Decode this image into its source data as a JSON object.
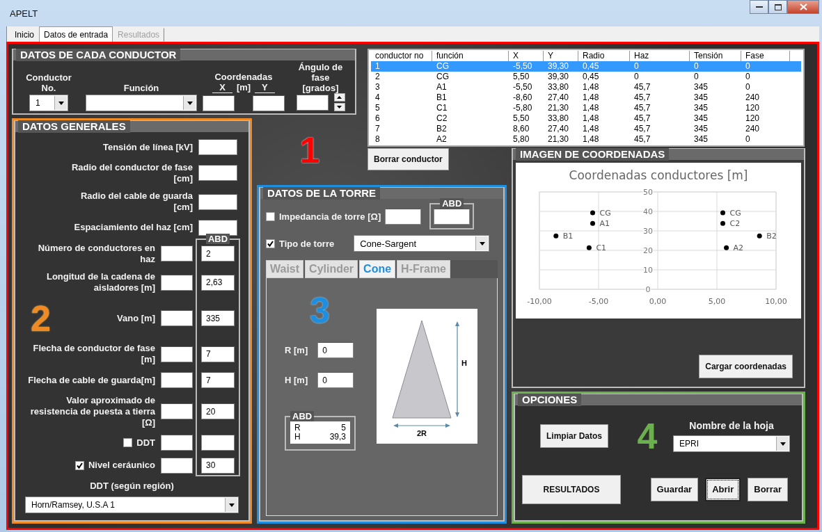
{
  "window": {
    "title": "APELT"
  },
  "tabs": [
    {
      "label": "Inicio",
      "selected": false,
      "disabled": false
    },
    {
      "label": "Datos de entrada",
      "selected": true,
      "disabled": false
    },
    {
      "label": "Resultados",
      "selected": false,
      "disabled": true
    }
  ],
  "frame": {
    "marker": "1",
    "color": "#ff0000"
  },
  "conductor_data": {
    "title": "DATOS DE CADA CONDUCTOR",
    "conductor_label": "Conductor No.",
    "conductor_value": "1",
    "function_label": "Función",
    "coords_label": "Coordenadas",
    "x_label": "X",
    "unit_label": "[m]",
    "y_label": "Y",
    "angle_label": "Ángulo de fase [grados]"
  },
  "table": {
    "columns": [
      "conductor no",
      "función",
      "X",
      "Y",
      "Radio",
      "Haz",
      "Tensión",
      "Fase"
    ],
    "rows": [
      {
        "cells": [
          "1",
          "CG",
          "-5,50",
          "39,30",
          "0,45",
          "0",
          "0",
          "0"
        ],
        "selected": true
      },
      {
        "cells": [
          "2",
          "CG",
          "5,50",
          "39,30",
          "0,45",
          "0",
          "0",
          "0"
        ],
        "selected": false
      },
      {
        "cells": [
          "3",
          "A1",
          "-5,50",
          "33,80",
          "1,48",
          "45,7",
          "345",
          "0"
        ],
        "selected": false
      },
      {
        "cells": [
          "4",
          "B1",
          "-8,60",
          "27,40",
          "1,48",
          "45,7",
          "345",
          "240"
        ],
        "selected": false
      },
      {
        "cells": [
          "5",
          "C1",
          "-5,80",
          "21,30",
          "1,48",
          "45,7",
          "345",
          "120"
        ],
        "selected": false
      },
      {
        "cells": [
          "6",
          "C2",
          "5,50",
          "33,80",
          "1,48",
          "45,7",
          "345",
          "120"
        ],
        "selected": false
      },
      {
        "cells": [
          "7",
          "B2",
          "8,60",
          "27,40",
          "1,48",
          "45,7",
          "345",
          "240"
        ],
        "selected": false
      },
      {
        "cells": [
          "8",
          "A2",
          "5,80",
          "21,30",
          "1,48",
          "45,7",
          "345",
          "0"
        ],
        "selected": false
      }
    ]
  },
  "delete_button": "Borrar conductor",
  "general": {
    "title": "DATOS GENERALES",
    "marker": "2",
    "color": "#f08a24",
    "abd_title": "ABD",
    "fields": [
      {
        "kind": "text",
        "label": "Tensión de línea [kV]",
        "has_abd": false
      },
      {
        "kind": "text",
        "label": "Radio del conductor de fase [cm]",
        "has_abd": false
      },
      {
        "kind": "text",
        "label": "Radio del cable de guarda [cm]",
        "has_abd": false
      },
      {
        "kind": "text",
        "label": "Espaciamiento del haz [cm]",
        "has_abd": false
      },
      {
        "kind": "text",
        "label": "Número de conductores en haz",
        "has_abd": true,
        "abd": "2"
      },
      {
        "kind": "text",
        "label": "Longitud de la cadena de aisladores [m]",
        "has_abd": true,
        "abd": "2,63"
      },
      {
        "kind": "text",
        "label": "Vano [m]",
        "has_abd": true,
        "abd": "335"
      },
      {
        "kind": "text",
        "label": "Flecha de conductor de fase [m]",
        "has_abd": true,
        "abd": "7"
      },
      {
        "kind": "text",
        "label": "Flecha de cable de guarda[m]",
        "has_abd": true,
        "abd": "7"
      },
      {
        "kind": "text",
        "label": "Valor aproximado de resistencia de puesta a tierra [Ω]",
        "has_abd": true,
        "abd": "20"
      },
      {
        "kind": "checkbox",
        "label": "DDT",
        "checked": false,
        "has_abd": true
      },
      {
        "kind": "checkbox",
        "label": "Nivel ceráunico",
        "checked": true,
        "has_abd": true,
        "abd": "30"
      }
    ],
    "region_label": "DDT (según región)",
    "region_value": "Horn/Ramsey, U.S.A 1"
  },
  "tower": {
    "title": "DATOS DE LA TORRE",
    "marker": "3",
    "color": "#1e8fe0",
    "abd_title": "ABD",
    "impedance": {
      "label": "Impedancia de torre [Ω]",
      "checked": false
    },
    "type": {
      "label": "Tipo de torre",
      "checked": true,
      "value": "Cone-Sargent"
    },
    "tabs": [
      {
        "label": "Waist",
        "selected": false
      },
      {
        "label": "Cylinder",
        "selected": false
      },
      {
        "label": "Cone",
        "selected": true
      },
      {
        "label": "H-Frame",
        "selected": false
      }
    ],
    "r_label": "R [m]",
    "r_value": "0",
    "h_label": "H [m]",
    "h_value": "0",
    "diagram": {
      "height_label": "H",
      "base_label": "2R"
    },
    "abd_box": {
      "title": "ABD",
      "rows": [
        {
          "name": "R",
          "value": "5"
        },
        {
          "name": "H",
          "value": "39,3"
        }
      ]
    }
  },
  "coords": {
    "title": "IMAGEN DE COORDENADAS",
    "load_button": "Cargar coordenadas",
    "chart_data": {
      "type": "scatter",
      "title": "Coordenadas conductores [m]",
      "x": [
        -5.5,
        5.5,
        -5.5,
        -8.6,
        -5.8,
        5.5,
        8.6,
        5.8
      ],
      "grid": true,
      "series": [
        {
          "color": "#000000",
          "values": [
            39.3,
            39.3,
            33.8,
            27.4,
            21.3,
            33.8,
            27.4,
            21.3
          ]
        }
      ],
      "value_labels": [
        "CG",
        "CG",
        "A1",
        "B1",
        "C1",
        "C2",
        "B2",
        "A2"
      ],
      "xlim": [
        -10,
        10
      ],
      "ylim": [
        0,
        50
      ],
      "xticks": [
        {
          "value": -10,
          "label": "-10,00"
        },
        {
          "value": -5,
          "label": "-5,00"
        },
        {
          "value": 0,
          "label": "0,00"
        },
        {
          "value": 5,
          "label": "5,00"
        },
        {
          "value": 10,
          "label": "10,00"
        }
      ],
      "yticks": [
        0,
        10,
        20,
        30,
        40,
        50
      ]
    }
  },
  "options": {
    "title": "OPCIONES",
    "marker": "4",
    "color": "#6ab04c",
    "clear_button": "Limpiar Datos",
    "sheet_label": "Nombre de la hoja",
    "sheet_value": "EPRI",
    "results_button": "RESULTADOS",
    "buttons": [
      {
        "label": "Guardar",
        "focused": false
      },
      {
        "label": "Abrir",
        "focused": true
      },
      {
        "label": "Borrar",
        "focused": false
      }
    ]
  }
}
